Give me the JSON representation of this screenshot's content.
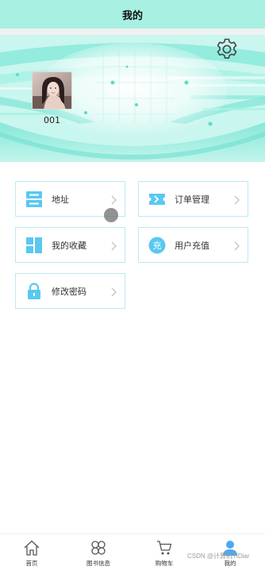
{
  "header": {
    "title": "我的"
  },
  "profile": {
    "username": "001"
  },
  "menu": {
    "address": "地址",
    "orders": "订单管理",
    "favorites": "我的收藏",
    "recharge": "用户充值",
    "recharge_icon_text": "充",
    "password": "修改密码"
  },
  "tabbar": {
    "home": "首页",
    "books": "图书信息",
    "cart": "购物车",
    "mine": "我的"
  },
  "watermark": "CSDN @计算机YiDiar",
  "colors": {
    "accent": "#5ac8f0",
    "header_bg": "#a8f0e2",
    "banner_teal": "#7fe6d6"
  },
  "icons": [
    "gear-icon",
    "address-icon",
    "ticket-icon",
    "grid-icon",
    "recharge-icon",
    "lock-icon",
    "chevron-right-icon",
    "home-icon",
    "clover-icon",
    "cart-icon",
    "user-icon"
  ]
}
